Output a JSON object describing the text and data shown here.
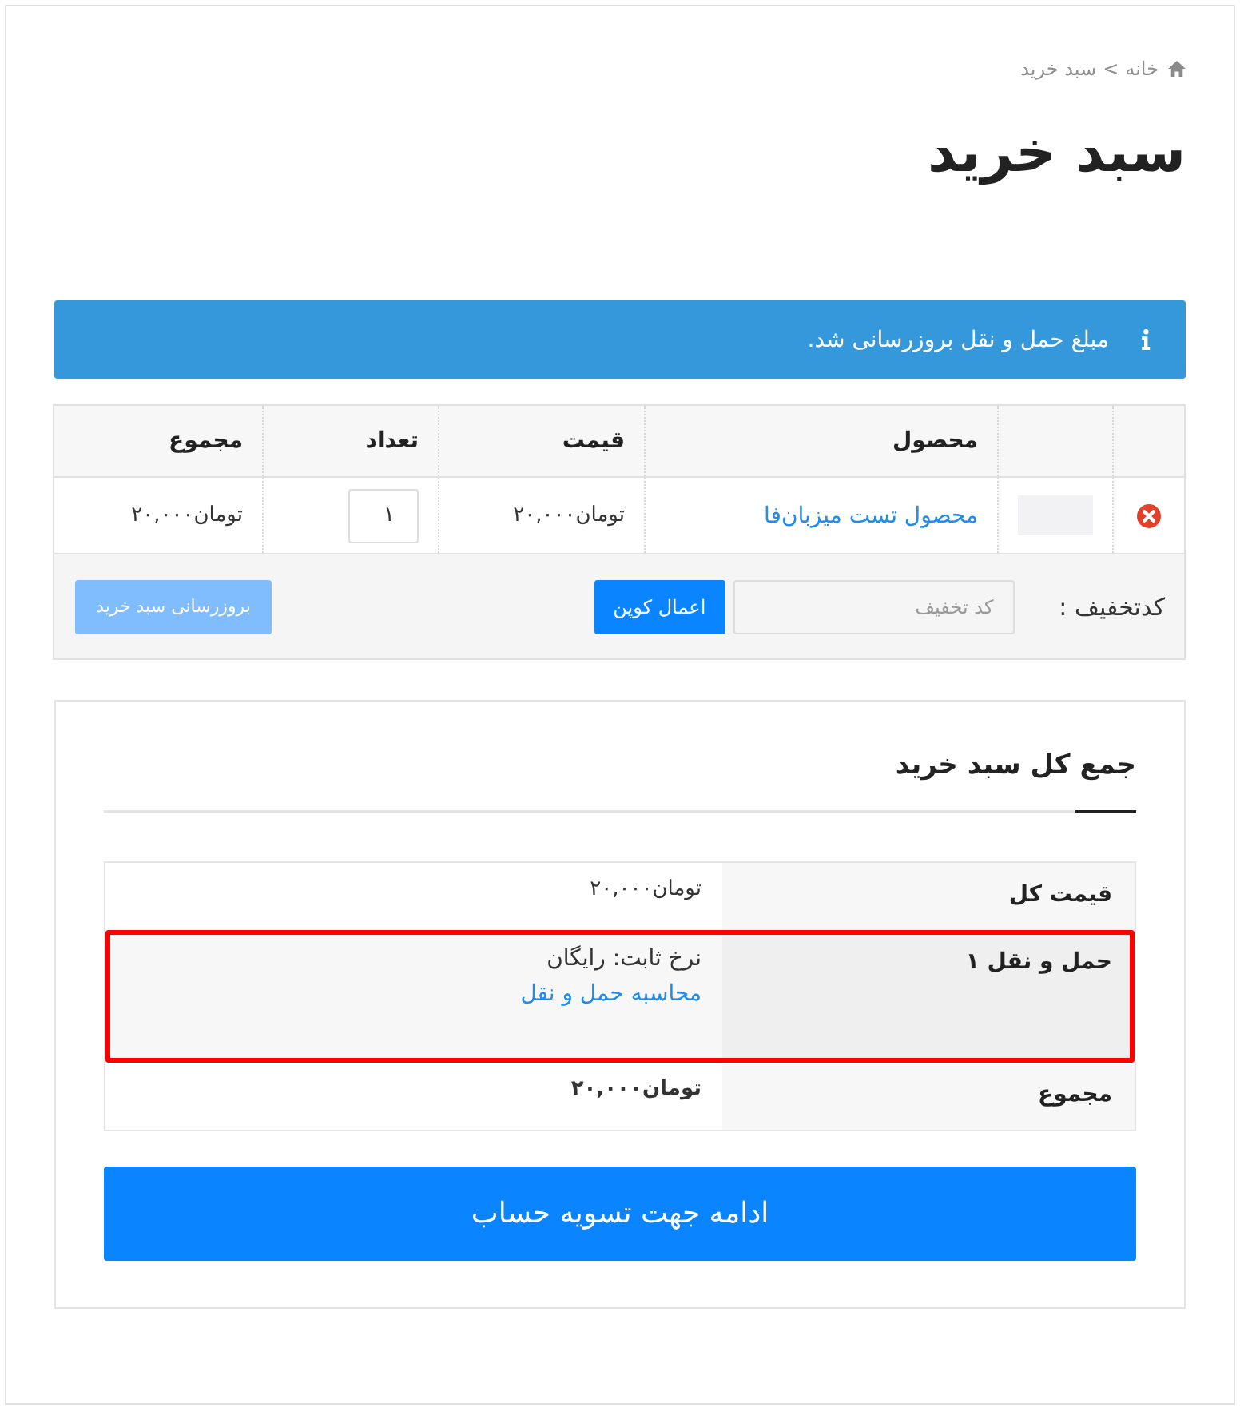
{
  "breadcrumb": {
    "items": [
      "خانه",
      "سبد خرید"
    ],
    "separator": ">"
  },
  "title": "سبد خرید",
  "notice": {
    "kind": "info",
    "text": "مبلغ حمل و نقل بروزرسانی شد."
  },
  "cart_table": {
    "columns": [
      "محصول",
      "قیمت",
      "تعداد",
      "مجموع"
    ],
    "rows": [
      {
        "product": "محصول تست میزبان‌فا",
        "price": "تومان۲۰,۰۰۰",
        "quantity": "۱",
        "subtotal": "تومان۲۰,۰۰۰"
      }
    ]
  },
  "coupon": {
    "label": "کدتخفیف :",
    "placeholder": "کد تخفیف",
    "button": "اعمال کوپن"
  },
  "update_button": {
    "label": "بروزرسانی سبد خرید",
    "disabled": true
  },
  "cart_totals": {
    "title": "جمع کل سبد خرید",
    "rows": [
      {
        "kind": "amount",
        "label": "قیمت کل",
        "value": "تومان۲۰,۰۰۰",
        "highlighted": false
      },
      {
        "kind": "shipping",
        "label": "حمل و نقل ۱",
        "value": "نرخ ثابت: رایگان",
        "link": "محاسبه حمل و نقل",
        "highlighted": true
      },
      {
        "kind": "total",
        "label": "مجموع",
        "value": "تومان۲۰,۰۰۰",
        "highlighted": false
      }
    ]
  },
  "checkout_button": "ادامه جهت تسویه حساب"
}
